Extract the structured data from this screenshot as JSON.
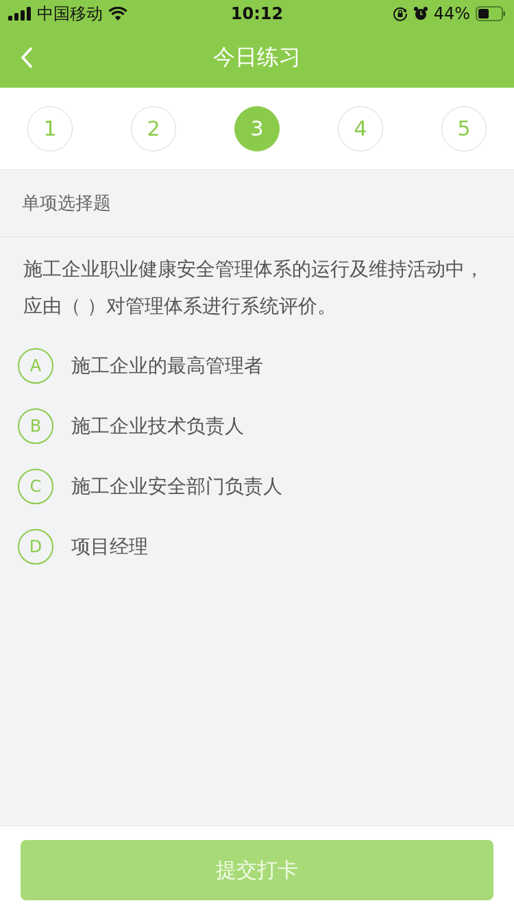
{
  "status_bar": {
    "carrier": "中国移动",
    "time": "10:12",
    "battery": "44%"
  },
  "nav": {
    "title": "今日练习"
  },
  "question_tabs": [
    {
      "label": "1",
      "selected": false
    },
    {
      "label": "2",
      "selected": false
    },
    {
      "label": "3",
      "selected": true
    },
    {
      "label": "4",
      "selected": false
    },
    {
      "label": "5",
      "selected": false
    }
  ],
  "section": {
    "title": "单项选择题"
  },
  "question": {
    "text": "施工企业职业健康安全管理体系的运行及维持活动中，应由（   ）对管理体系进行系统评价。"
  },
  "options": [
    {
      "letter": "A",
      "text": "施工企业的最高管理者",
      "selected": false
    },
    {
      "letter": "B",
      "text": "施工企业技术负责人",
      "selected": false
    },
    {
      "letter": "C",
      "text": "施工企业安全部门负责人",
      "selected": false
    },
    {
      "letter": "D",
      "text": "项目经理",
      "selected": false
    }
  ],
  "submit": {
    "label": "提交打卡",
    "disabled": true
  }
}
